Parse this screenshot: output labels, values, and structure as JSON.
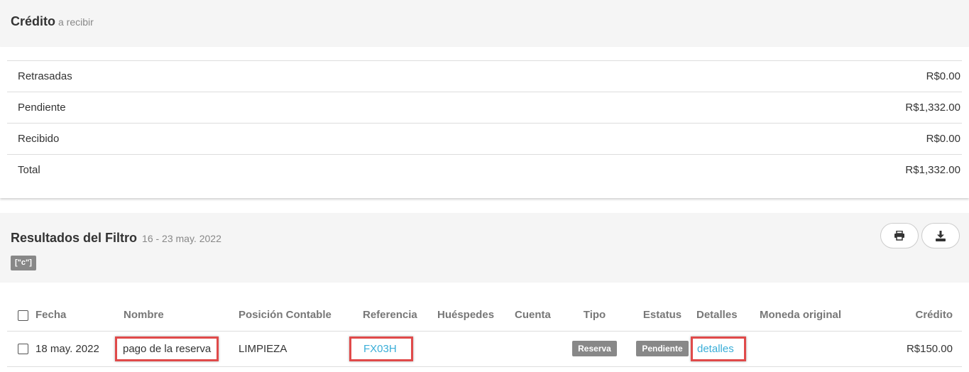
{
  "credit": {
    "title": "Crédito",
    "subtitle": "a recibir",
    "rows": [
      {
        "label": "Retrasadas",
        "amount": "R$0.00"
      },
      {
        "label": "Pendiente",
        "amount": "R$1,332.00"
      },
      {
        "label": "Recibido",
        "amount": "R$0.00"
      },
      {
        "label": "Total",
        "amount": "R$1,332.00"
      }
    ]
  },
  "results": {
    "title": "Resultados del Filtro",
    "date_range": "16 - 23 may. 2022",
    "filter_tag": "[\"c\"]",
    "toolbar": {
      "print_icon": "print-icon",
      "download_icon": "download-icon"
    },
    "columns": [
      "Fecha",
      "Nombre",
      "Posición Contable",
      "Referencia",
      "Huéspedes",
      "Cuenta",
      "Tipo",
      "Estatus",
      "Detalles",
      "Moneda original",
      "Crédito"
    ],
    "rows": [
      {
        "fecha": "18 may. 2022",
        "nombre": "pago de la reserva",
        "posicion": "LIMPIEZA",
        "referencia": "FX03H",
        "huespedes": "",
        "cuenta": "",
        "tipo": "Reserva",
        "estatus": "Pendiente",
        "detalles": "detalles",
        "moneda": "",
        "credito": "R$150.00"
      }
    ]
  },
  "colors": {
    "link": "#3aaed8",
    "badge": "#888888",
    "highlight": "#e04a4a"
  }
}
